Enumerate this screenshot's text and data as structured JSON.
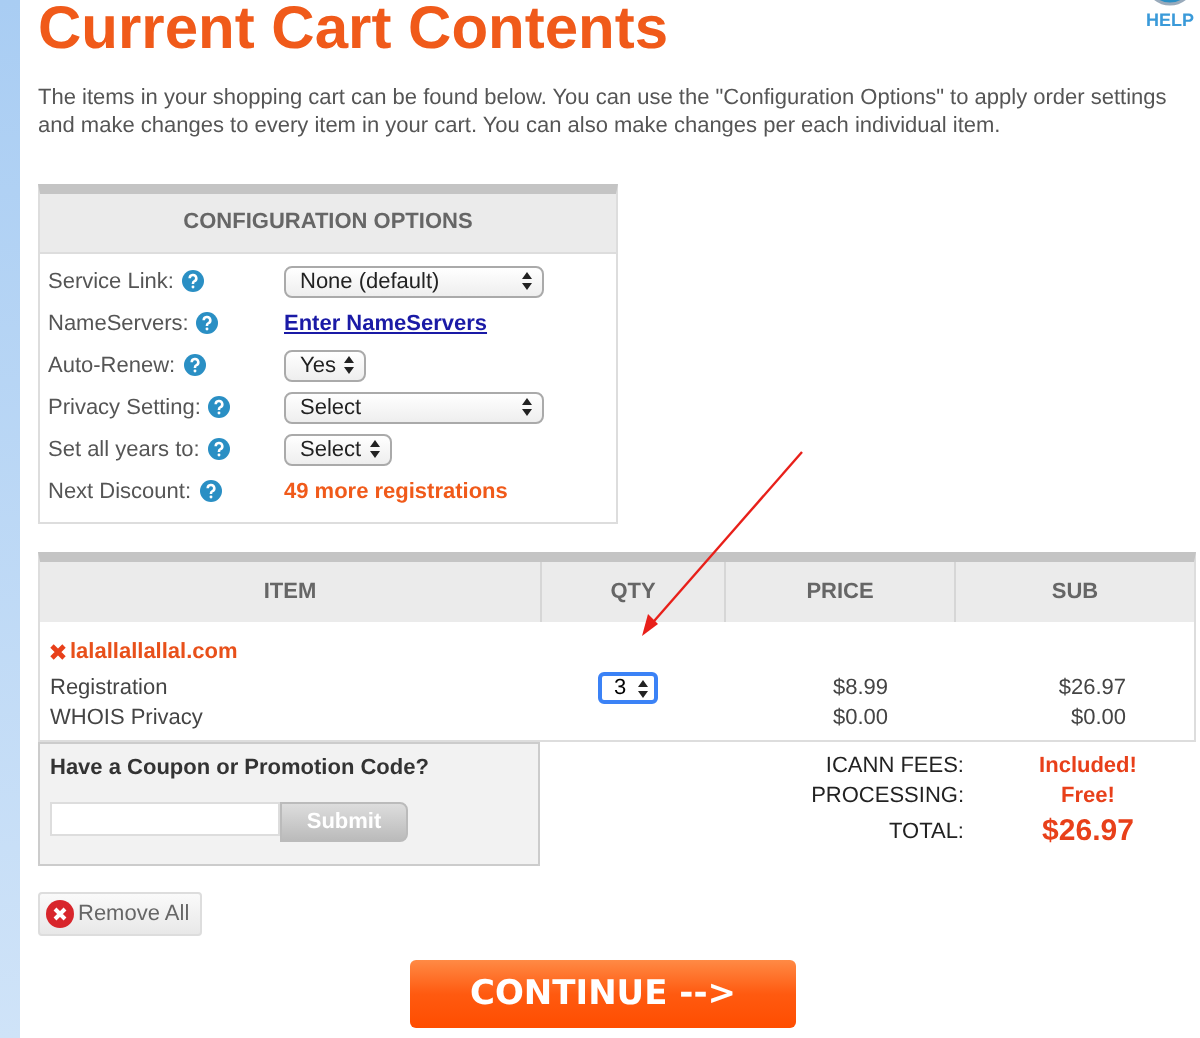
{
  "title": "Current Cart Contents",
  "help": {
    "label": "HELP"
  },
  "intro": "The items in your shopping cart can be found below. You can use the \"Configuration Options\" to apply order settings and make changes to every item in your cart. You can also make changes per each individual item.",
  "config": {
    "heading": "CONFIGURATION OPTIONS",
    "rows": [
      {
        "label": "Service Link:",
        "kind": "select",
        "value": "None (default)",
        "wide": true
      },
      {
        "label": "NameServers:",
        "kind": "link",
        "value": "Enter NameServers"
      },
      {
        "label": "Auto-Renew:",
        "kind": "select",
        "value": "Yes",
        "wide": false
      },
      {
        "label": "Privacy Setting:",
        "kind": "select",
        "value": "Select",
        "wide": true
      },
      {
        "label": "Set all years to:",
        "kind": "select",
        "value": "Select",
        "wide": false
      },
      {
        "label": "Next Discount:",
        "kind": "note",
        "value": "49 more registrations"
      }
    ]
  },
  "cart": {
    "columns": [
      "ITEM",
      "QTY",
      "PRICE",
      "SUB"
    ],
    "domain": "lalallallallal.com",
    "lines": [
      {
        "item": "Registration",
        "qty": "3",
        "price": "$8.99",
        "sub": "$26.97"
      },
      {
        "item": "WHOIS Privacy",
        "price": "$0.00",
        "sub": "$0.00"
      }
    ]
  },
  "coupon": {
    "heading": "Have a Coupon or Promotion Code?",
    "button": "Submit"
  },
  "totals": [
    {
      "label": "ICANN FEES:",
      "value": "Included!",
      "big": false
    },
    {
      "label": "PROCESSING:",
      "value": "Free!",
      "big": false
    },
    {
      "label": "TOTAL:",
      "value": "$26.97",
      "big": true
    }
  ],
  "remove_all": "Remove All",
  "continue": "CONTINUE -->"
}
